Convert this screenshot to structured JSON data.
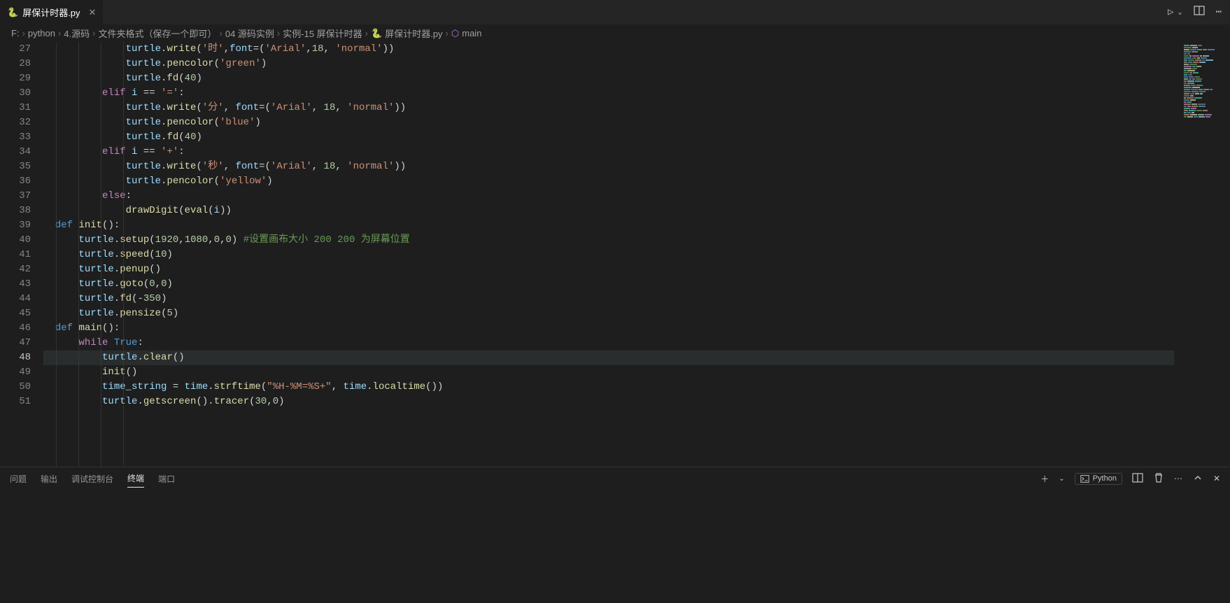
{
  "tab": {
    "filename": "屏保计时器.py"
  },
  "toolbar": {
    "run": "▷",
    "split": "⫿⫿",
    "more": "⋯"
  },
  "breadcrumbs": {
    "items": [
      "F:",
      "python",
      "4.源码",
      "文件夹格式（保存一个即可）",
      "04 源码实例",
      "实例-15 屏保计时器",
      "屏保计时器.py",
      "main"
    ]
  },
  "editor": {
    "first_line": 27,
    "current_line": 48,
    "lines": [
      {
        "n": 27,
        "indent": 3,
        "t": [
          [
            "var",
            "turtle"
          ],
          [
            "op",
            "."
          ],
          [
            "fn",
            "write"
          ],
          [
            "op",
            "("
          ],
          [
            "str",
            "'时'"
          ],
          [
            "op",
            ","
          ],
          [
            "var",
            "font"
          ],
          [
            "op",
            "=("
          ],
          [
            "str",
            "'Arial'"
          ],
          [
            "op",
            ","
          ],
          [
            "num",
            "18"
          ],
          [
            "op",
            ", "
          ],
          [
            "str",
            "'normal'"
          ],
          [
            "op",
            "))"
          ]
        ]
      },
      {
        "n": 28,
        "indent": 3,
        "t": [
          [
            "var",
            "turtle"
          ],
          [
            "op",
            "."
          ],
          [
            "fn",
            "pencolor"
          ],
          [
            "op",
            "("
          ],
          [
            "str",
            "'green'"
          ],
          [
            "op",
            ")"
          ]
        ]
      },
      {
        "n": 29,
        "indent": 3,
        "t": [
          [
            "var",
            "turtle"
          ],
          [
            "op",
            "."
          ],
          [
            "fn",
            "fd"
          ],
          [
            "op",
            "("
          ],
          [
            "num",
            "40"
          ],
          [
            "op",
            ")"
          ]
        ]
      },
      {
        "n": 30,
        "indent": 2,
        "t": [
          [
            "kw",
            "elif"
          ],
          [
            "op",
            " "
          ],
          [
            "var",
            "i"
          ],
          [
            "op",
            " == "
          ],
          [
            "str",
            "'='"
          ],
          [
            "op",
            ":"
          ]
        ]
      },
      {
        "n": 31,
        "indent": 3,
        "t": [
          [
            "var",
            "turtle"
          ],
          [
            "op",
            "."
          ],
          [
            "fn",
            "write"
          ],
          [
            "op",
            "("
          ],
          [
            "str",
            "'分'"
          ],
          [
            "op",
            ", "
          ],
          [
            "var",
            "font"
          ],
          [
            "op",
            "=("
          ],
          [
            "str",
            "'Arial'"
          ],
          [
            "op",
            ", "
          ],
          [
            "num",
            "18"
          ],
          [
            "op",
            ", "
          ],
          [
            "str",
            "'normal'"
          ],
          [
            "op",
            "))"
          ]
        ]
      },
      {
        "n": 32,
        "indent": 3,
        "t": [
          [
            "var",
            "turtle"
          ],
          [
            "op",
            "."
          ],
          [
            "fn",
            "pencolor"
          ],
          [
            "op",
            "("
          ],
          [
            "str",
            "'blue'"
          ],
          [
            "op",
            ")"
          ]
        ]
      },
      {
        "n": 33,
        "indent": 3,
        "t": [
          [
            "var",
            "turtle"
          ],
          [
            "op",
            "."
          ],
          [
            "fn",
            "fd"
          ],
          [
            "op",
            "("
          ],
          [
            "num",
            "40"
          ],
          [
            "op",
            ")"
          ]
        ]
      },
      {
        "n": 34,
        "indent": 2,
        "t": [
          [
            "kw",
            "elif"
          ],
          [
            "op",
            " "
          ],
          [
            "var",
            "i"
          ],
          [
            "op",
            " == "
          ],
          [
            "str",
            "'+'"
          ],
          [
            "op",
            ":"
          ]
        ]
      },
      {
        "n": 35,
        "indent": 3,
        "t": [
          [
            "var",
            "turtle"
          ],
          [
            "op",
            "."
          ],
          [
            "fn",
            "write"
          ],
          [
            "op",
            "("
          ],
          [
            "str",
            "'秒'"
          ],
          [
            "op",
            ", "
          ],
          [
            "var",
            "font"
          ],
          [
            "op",
            "=("
          ],
          [
            "str",
            "'Arial'"
          ],
          [
            "op",
            ", "
          ],
          [
            "num",
            "18"
          ],
          [
            "op",
            ", "
          ],
          [
            "str",
            "'normal'"
          ],
          [
            "op",
            "))"
          ]
        ]
      },
      {
        "n": 36,
        "indent": 3,
        "t": [
          [
            "var",
            "turtle"
          ],
          [
            "op",
            "."
          ],
          [
            "fn",
            "pencolor"
          ],
          [
            "op",
            "("
          ],
          [
            "str",
            "'yellow'"
          ],
          [
            "op",
            ")"
          ]
        ]
      },
      {
        "n": 37,
        "indent": 2,
        "t": [
          [
            "kw",
            "else"
          ],
          [
            "op",
            ":"
          ]
        ]
      },
      {
        "n": 38,
        "indent": 3,
        "t": [
          [
            "fn",
            "drawDigit"
          ],
          [
            "op",
            "("
          ],
          [
            "fn",
            "eval"
          ],
          [
            "op",
            "("
          ],
          [
            "var",
            "i"
          ],
          [
            "op",
            "))"
          ]
        ]
      },
      {
        "n": 39,
        "indent": 0,
        "t": [
          [
            "kw2",
            "def"
          ],
          [
            "op",
            " "
          ],
          [
            "fn",
            "init"
          ],
          [
            "op",
            "():"
          ]
        ]
      },
      {
        "n": 40,
        "indent": 1,
        "t": [
          [
            "var",
            "turtle"
          ],
          [
            "op",
            "."
          ],
          [
            "fn",
            "setup"
          ],
          [
            "op",
            "("
          ],
          [
            "num",
            "1920"
          ],
          [
            "op",
            ","
          ],
          [
            "num",
            "1080"
          ],
          [
            "op",
            ","
          ],
          [
            "num",
            "0"
          ],
          [
            "op",
            ","
          ],
          [
            "num",
            "0"
          ],
          [
            "op",
            ") "
          ],
          [
            "cmt",
            "#设置画布大小 200 200 为屏幕位置"
          ]
        ]
      },
      {
        "n": 41,
        "indent": 1,
        "t": [
          [
            "var",
            "turtle"
          ],
          [
            "op",
            "."
          ],
          [
            "fn",
            "speed"
          ],
          [
            "op",
            "("
          ],
          [
            "num",
            "10"
          ],
          [
            "op",
            ")"
          ]
        ]
      },
      {
        "n": 42,
        "indent": 1,
        "t": [
          [
            "var",
            "turtle"
          ],
          [
            "op",
            "."
          ],
          [
            "fn",
            "penup"
          ],
          [
            "op",
            "()"
          ]
        ]
      },
      {
        "n": 43,
        "indent": 1,
        "t": [
          [
            "var",
            "turtle"
          ],
          [
            "op",
            "."
          ],
          [
            "fn",
            "goto"
          ],
          [
            "op",
            "("
          ],
          [
            "num",
            "0"
          ],
          [
            "op",
            ","
          ],
          [
            "num",
            "0"
          ],
          [
            "op",
            ")"
          ]
        ]
      },
      {
        "n": 44,
        "indent": 1,
        "t": [
          [
            "var",
            "turtle"
          ],
          [
            "op",
            "."
          ],
          [
            "fn",
            "fd"
          ],
          [
            "op",
            "(-"
          ],
          [
            "num",
            "350"
          ],
          [
            "op",
            ")"
          ]
        ]
      },
      {
        "n": 45,
        "indent": 1,
        "t": [
          [
            "var",
            "turtle"
          ],
          [
            "op",
            "."
          ],
          [
            "fn",
            "pensize"
          ],
          [
            "op",
            "("
          ],
          [
            "num",
            "5"
          ],
          [
            "op",
            ")"
          ]
        ]
      },
      {
        "n": 46,
        "indent": 0,
        "t": [
          [
            "kw2",
            "def"
          ],
          [
            "op",
            " "
          ],
          [
            "fn",
            "main"
          ],
          [
            "op",
            "():"
          ]
        ]
      },
      {
        "n": 47,
        "indent": 1,
        "t": [
          [
            "kw",
            "while"
          ],
          [
            "op",
            " "
          ],
          [
            "const",
            "True"
          ],
          [
            "op",
            ":"
          ]
        ]
      },
      {
        "n": 48,
        "indent": 2,
        "t": [
          [
            "var",
            "turtle"
          ],
          [
            "op",
            "."
          ],
          [
            "fn",
            "clear"
          ],
          [
            "op",
            "()"
          ]
        ]
      },
      {
        "n": 49,
        "indent": 2,
        "t": [
          [
            "fn",
            "init"
          ],
          [
            "op",
            "()"
          ]
        ]
      },
      {
        "n": 50,
        "indent": 2,
        "t": [
          [
            "var",
            "time_string"
          ],
          [
            "op",
            " = "
          ],
          [
            "var",
            "time"
          ],
          [
            "op",
            "."
          ],
          [
            "fn",
            "strftime"
          ],
          [
            "op",
            "("
          ],
          [
            "str",
            "\"%H-%M=%S+\""
          ],
          [
            "op",
            ", "
          ],
          [
            "var",
            "time"
          ],
          [
            "op",
            "."
          ],
          [
            "fn",
            "localtime"
          ],
          [
            "op",
            "())"
          ]
        ]
      },
      {
        "n": 51,
        "indent": 2,
        "t": [
          [
            "var",
            "turtle"
          ],
          [
            "op",
            "."
          ],
          [
            "fn",
            "getscreen"
          ],
          [
            "op",
            "()."
          ],
          [
            "fn",
            "tracer"
          ],
          [
            "op",
            "("
          ],
          [
            "num",
            "30"
          ],
          [
            "op",
            ","
          ],
          [
            "num",
            "0"
          ],
          [
            "op",
            ")"
          ]
        ]
      }
    ]
  },
  "panel": {
    "tabs": {
      "problems": "问题",
      "output": "输出",
      "debug": "调试控制台",
      "terminal": "终端",
      "ports": "端口"
    },
    "active": "terminal",
    "lang": "Python"
  }
}
